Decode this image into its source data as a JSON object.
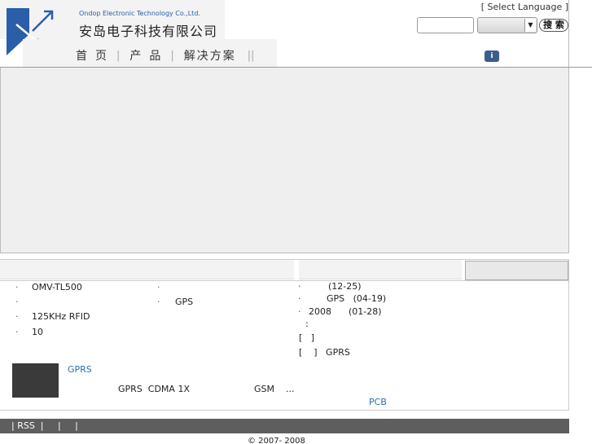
{
  "header": {
    "logo_text": "ondop",
    "company_en": "Ondop Electronic Technology Co.,Ltd.",
    "company_cn": "安岛电子科技有限公司",
    "select_language": "[ Select Language ]",
    "search_button": "搜 索",
    "search_input_value": "",
    "search_select_value": ""
  },
  "nav": {
    "items": [
      "首页",
      "产品",
      "解决方案"
    ],
    "separator": "|",
    "trailing_separator": "||"
  },
  "left_list": {
    "items": [
      "OMV-TL500",
      "",
      "125KHz RFID",
      "10"
    ],
    "col2_items": [
      "",
      "GPS"
    ],
    "bullet": "·"
  },
  "news_list": {
    "items": [
      "(12-25)",
      "GPS   (04-19)",
      "2008      (01-28)",
      ":",
      "[   ]",
      "[    ]   GPRS"
    ],
    "bullet": "·"
  },
  "feature": {
    "title": "GPRS",
    "desc_left": "GPRS  CDMA 1X",
    "desc_right": "GSM    ...",
    "pcb_link": "PCB"
  },
  "footer": {
    "links_text": "| RSS  |     |     |",
    "copyright": "© 2007- 2008"
  },
  "colors": {
    "brand_blue": "#2a5ea8",
    "link_blue": "#2a6fb0",
    "footer_gray": "#5e5e5e"
  }
}
